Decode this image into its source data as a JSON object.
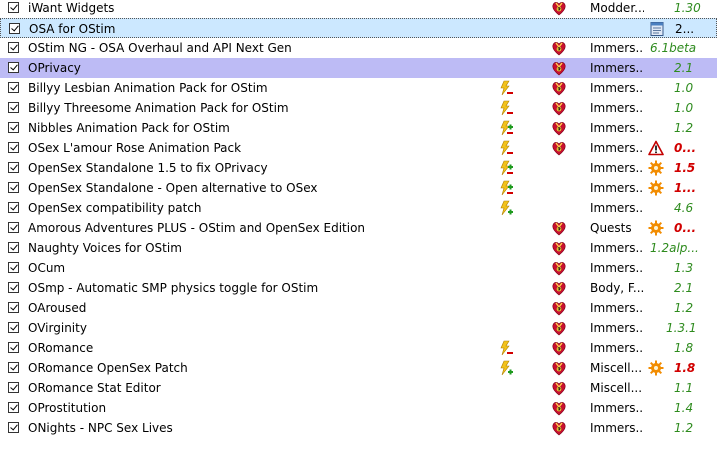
{
  "colors": {
    "selected_row": "#cce8ff",
    "highlighted_row": "#bdbbf5",
    "version_ok": "#2e8b1e",
    "version_problem": "#d10000"
  },
  "mods": [
    {
      "name": "iWant Widgets",
      "checked": true,
      "conflict": "",
      "nexus": true,
      "category": "Modder...",
      "flag": "",
      "version": "1.30",
      "version_style": "green"
    },
    {
      "name": "OSA for OStim",
      "checked": true,
      "conflict": "",
      "nexus": false,
      "category": "",
      "flag": "notes-icon",
      "version": "2...",
      "version_style": "black",
      "state": "selected"
    },
    {
      "name": "OStim NG - OSA Overhaul and API Next Gen",
      "checked": true,
      "conflict": "",
      "nexus": true,
      "category": "Immers...",
      "flag": "",
      "version": "6.1beta",
      "version_style": "green"
    },
    {
      "name": "OPrivacy",
      "checked": true,
      "conflict": "",
      "nexus": true,
      "category": "Immers...",
      "flag": "",
      "version": "2.1",
      "version_style": "green",
      "state": "highlight"
    },
    {
      "name": "Billyy Lesbian Animation Pack for OStim",
      "checked": true,
      "conflict": "overwritten",
      "nexus": true,
      "category": "Immers...",
      "flag": "",
      "version": "1.0",
      "version_style": "green"
    },
    {
      "name": "Billyy Threesome Animation Pack for OStim",
      "checked": true,
      "conflict": "overwritten",
      "nexus": true,
      "category": "Immers...",
      "flag": "",
      "version": "1.0",
      "version_style": "green"
    },
    {
      "name": "Nibbles Animation Pack for OStim",
      "checked": true,
      "conflict": "mixed",
      "nexus": true,
      "category": "Immers...",
      "flag": "",
      "version": "1.2",
      "version_style": "green"
    },
    {
      "name": "OSex L'amour Rose Animation Pack",
      "checked": true,
      "conflict": "overwritten",
      "nexus": true,
      "category": "Immers...",
      "flag": "warning-icon",
      "version": "0...",
      "version_style": "red"
    },
    {
      "name": "OpenSex Standalone 1.5 to fix OPrivacy",
      "checked": true,
      "conflict": "mixed",
      "nexus": false,
      "category": "Immers...",
      "flag": "gear-icon",
      "version": "1.5",
      "version_style": "red"
    },
    {
      "name": "OpenSex Standalone - Open alternative to OSex",
      "checked": true,
      "conflict": "mixed",
      "nexus": false,
      "category": "Immers...",
      "flag": "gear-icon",
      "version": "1...",
      "version_style": "red"
    },
    {
      "name": "OpenSex compatibility patch",
      "checked": true,
      "conflict": "overwrites",
      "nexus": false,
      "category": "Immers...",
      "flag": "",
      "version": "4.6",
      "version_style": "green"
    },
    {
      "name": "Amorous Adventures PLUS - OStim and OpenSex Edition",
      "checked": true,
      "conflict": "",
      "nexus": true,
      "category": "Quests",
      "flag": "gear-icon",
      "version": "0...",
      "version_style": "red"
    },
    {
      "name": "Naughty Voices for OStim",
      "checked": true,
      "conflict": "",
      "nexus": true,
      "category": "Immers...",
      "flag": "",
      "version": "1.2alp...",
      "version_style": "green"
    },
    {
      "name": "OCum",
      "checked": true,
      "conflict": "",
      "nexus": true,
      "category": "Immers...",
      "flag": "",
      "version": "1.3",
      "version_style": "green"
    },
    {
      "name": "OSmp - Automatic SMP physics toggle for OStim",
      "checked": true,
      "conflict": "",
      "nexus": true,
      "category": "Body, F...",
      "flag": "",
      "version": "2.1",
      "version_style": "green"
    },
    {
      "name": "OAroused",
      "checked": true,
      "conflict": "",
      "nexus": true,
      "category": "Immers...",
      "flag": "",
      "version": "1.2",
      "version_style": "green"
    },
    {
      "name": "OVirginity",
      "checked": true,
      "conflict": "",
      "nexus": true,
      "category": "Immers...",
      "flag": "",
      "version": "1.3.1",
      "version_style": "green"
    },
    {
      "name": "ORomance",
      "checked": true,
      "conflict": "overwritten",
      "nexus": true,
      "category": "Immers...",
      "flag": "",
      "version": "1.8",
      "version_style": "green"
    },
    {
      "name": "ORomance OpenSex Patch",
      "checked": true,
      "conflict": "overwrites",
      "nexus": true,
      "category": "Miscell...",
      "flag": "gear-icon",
      "version": "1.8",
      "version_style": "red"
    },
    {
      "name": "ORomance Stat Editor",
      "checked": true,
      "conflict": "",
      "nexus": true,
      "category": "Miscell...",
      "flag": "",
      "version": "1.1",
      "version_style": "green"
    },
    {
      "name": "OProstitution",
      "checked": true,
      "conflict": "",
      "nexus": true,
      "category": "Immers...",
      "flag": "",
      "version": "1.4",
      "version_style": "green"
    },
    {
      "name": "ONights - NPC Sex Lives",
      "checked": true,
      "conflict": "",
      "nexus": true,
      "category": "Immers...",
      "flag": "",
      "version": "1.2",
      "version_style": "green"
    },
    {
      "name": "",
      "checked": false,
      "conflict": "",
      "nexus": false,
      "category": "",
      "flag": "",
      "version": "",
      "version_style": "green",
      "partial": true
    }
  ]
}
